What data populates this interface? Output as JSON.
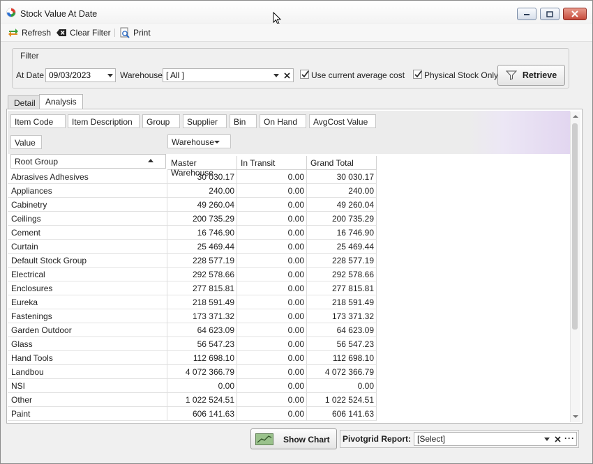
{
  "window": {
    "title": "Stock Value At Date"
  },
  "toolbar": {
    "refresh_label": "Refresh",
    "clear_filter_label": "Clear Filter",
    "print_label": "Print"
  },
  "filter": {
    "group_title": "Filter",
    "at_date_label": "At Date",
    "at_date_value": "09/03/2023",
    "warehouse_label": "Warehouse",
    "warehouse_value": "[ All ]",
    "use_avg_cost_label": "Use current average cost",
    "use_avg_cost_checked": true,
    "physical_only_label": "Physical Stock Only",
    "physical_only_checked": true,
    "retrieve_label": "Retrieve"
  },
  "tabs": [
    {
      "label": "Detail",
      "active": false
    },
    {
      "label": "Analysis",
      "active": true
    }
  ],
  "pivot": {
    "filter_fields": [
      "Item Code",
      "Item Description",
      "Group",
      "Supplier",
      "Bin",
      "On Hand",
      "AvgCost Value"
    ],
    "data_field": "Value",
    "column_field": "Warehouse",
    "row_field": "Root Group",
    "columns": [
      "Master Warehouse",
      "In Transit",
      "Grand Total"
    ],
    "rows": [
      {
        "label": "Abrasives Adhesives",
        "values": [
          "30 030.17",
          "0.00",
          "30 030.17"
        ]
      },
      {
        "label": "Appliances",
        "values": [
          "240.00",
          "0.00",
          "240.00"
        ]
      },
      {
        "label": "Cabinetry",
        "values": [
          "49 260.04",
          "0.00",
          "49 260.04"
        ]
      },
      {
        "label": "Ceilings",
        "values": [
          "200 735.29",
          "0.00",
          "200 735.29"
        ]
      },
      {
        "label": "Cement",
        "values": [
          "16 746.90",
          "0.00",
          "16 746.90"
        ]
      },
      {
        "label": "Curtain",
        "values": [
          "25 469.44",
          "0.00",
          "25 469.44"
        ]
      },
      {
        "label": "Default Stock Group",
        "values": [
          "228 577.19",
          "0.00",
          "228 577.19"
        ]
      },
      {
        "label": "Electrical",
        "values": [
          "292 578.66",
          "0.00",
          "292 578.66"
        ]
      },
      {
        "label": "Enclosures",
        "values": [
          "277 815.81",
          "0.00",
          "277 815.81"
        ]
      },
      {
        "label": "Eureka",
        "values": [
          "218 591.49",
          "0.00",
          "218 591.49"
        ]
      },
      {
        "label": "Fastenings",
        "values": [
          "173 371.32",
          "0.00",
          "173 371.32"
        ]
      },
      {
        "label": "Garden Outdoor",
        "values": [
          "64 623.09",
          "0.00",
          "64 623.09"
        ]
      },
      {
        "label": "Glass",
        "values": [
          "56 547.23",
          "0.00",
          "56 547.23"
        ]
      },
      {
        "label": "Hand Tools",
        "values": [
          "112 698.10",
          "0.00",
          "112 698.10"
        ]
      },
      {
        "label": "Landbou",
        "values": [
          "4 072 366.79",
          "0.00",
          "4 072 366.79"
        ]
      },
      {
        "label": "NSI",
        "values": [
          "0.00",
          "0.00",
          "0.00"
        ]
      },
      {
        "label": "Other",
        "values": [
          "1 022 524.51",
          "0.00",
          "1 022 524.51"
        ]
      },
      {
        "label": "Paint",
        "values": [
          "606 141.63",
          "0.00",
          "606 141.63"
        ]
      }
    ]
  },
  "bottom": {
    "show_chart_label": "Show Chart",
    "pivot_report_label": "Pivotgrid Report:",
    "pivot_report_value": "[Select]"
  }
}
